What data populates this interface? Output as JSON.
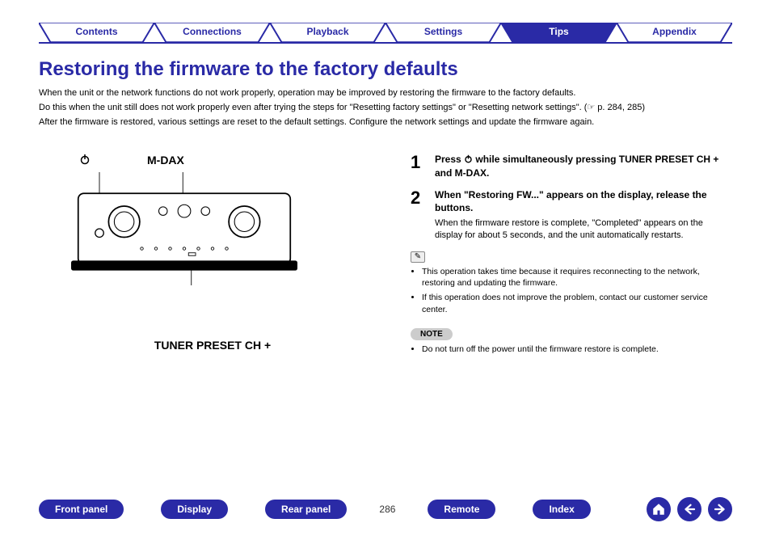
{
  "topnav": {
    "tabs": [
      {
        "label": "Contents"
      },
      {
        "label": "Connections"
      },
      {
        "label": "Playback"
      },
      {
        "label": "Settings"
      },
      {
        "label": "Tips",
        "active": true
      },
      {
        "label": "Appendix"
      }
    ]
  },
  "title": "Restoring the firmware to the factory defaults",
  "intro": {
    "p1": "When the unit or the network functions do not work properly, operation may be improved by restoring the firmware to the factory defaults.",
    "p2": "Do this when the unit still does not work properly even after trying the steps for \"Resetting factory settings\" or \"Resetting network settings\". (☞ p. 284, 285)",
    "p3": "After the firmware is restored, various settings are reset to the default settings. Configure the network settings and update the firmware again."
  },
  "diagram": {
    "label_mdax": "M-DAX",
    "label_tuner": "TUNER PRESET CH +"
  },
  "steps": [
    {
      "num": "1",
      "title_prefix": "Press ",
      "title_suffix": " while simultaneously pressing TUNER PRESET CH + and M-DAX."
    },
    {
      "num": "2",
      "title": "When \"Restoring FW...\" appears on the display, release the buttons.",
      "sub": "When the firmware restore is complete, \"Completed\" appears on the display for about 5 seconds, and the unit automatically restarts."
    }
  ],
  "tip_bullets": [
    "This operation takes time because it requires reconnecting to the network, restoring and updating the firmware.",
    "If this operation does not improve the problem, contact our customer service center."
  ],
  "note_label": "NOTE",
  "note_bullets": [
    "Do not turn off the power until the firmware restore is complete."
  ],
  "bottomnav": {
    "buttons": [
      "Front panel",
      "Display",
      "Rear panel"
    ],
    "page": "286",
    "buttons2": [
      "Remote",
      "Index"
    ]
  }
}
